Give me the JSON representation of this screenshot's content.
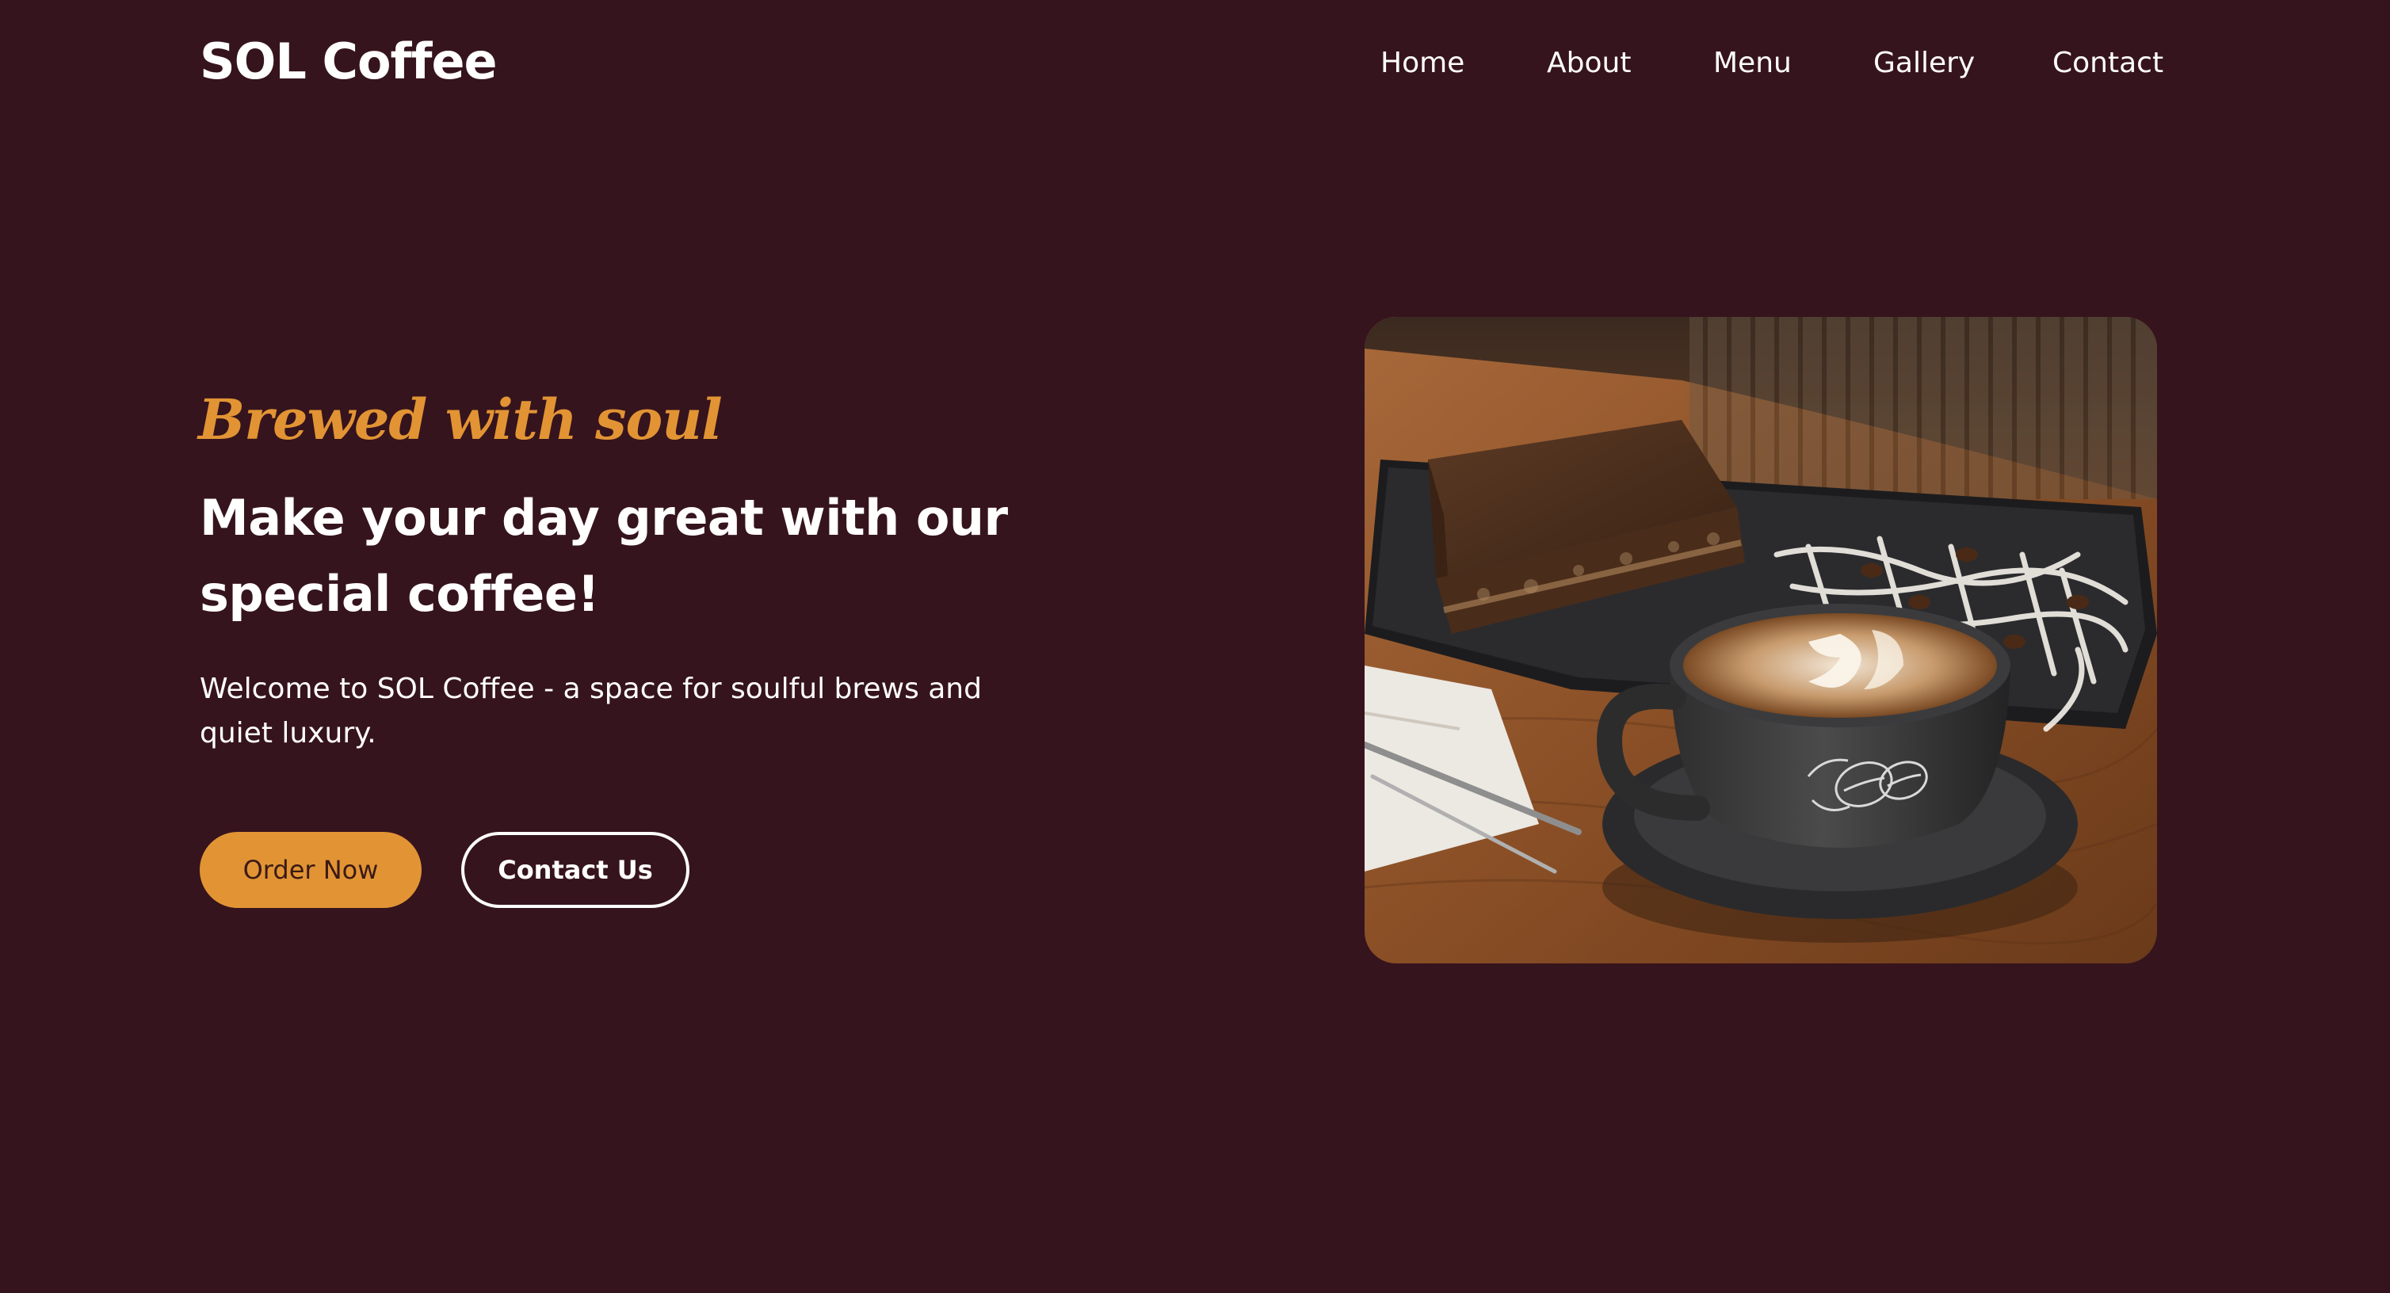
{
  "brand": {
    "name": "SOL Coffee"
  },
  "nav": {
    "items": [
      {
        "label": "Home"
      },
      {
        "label": "About"
      },
      {
        "label": "Menu"
      },
      {
        "label": "Gallery"
      },
      {
        "label": "Contact"
      }
    ]
  },
  "hero": {
    "tagline": "Brewed with soul",
    "headline": "Make your day great with our special coffee!",
    "intro": "Welcome to SOL Coffee - a space for soulful brews and quiet luxury.",
    "primary_button": "Order Now",
    "secondary_button": "Contact Us"
  },
  "colors": {
    "background": "#36141d",
    "accent": "#e29434",
    "text": "#ffffff"
  }
}
